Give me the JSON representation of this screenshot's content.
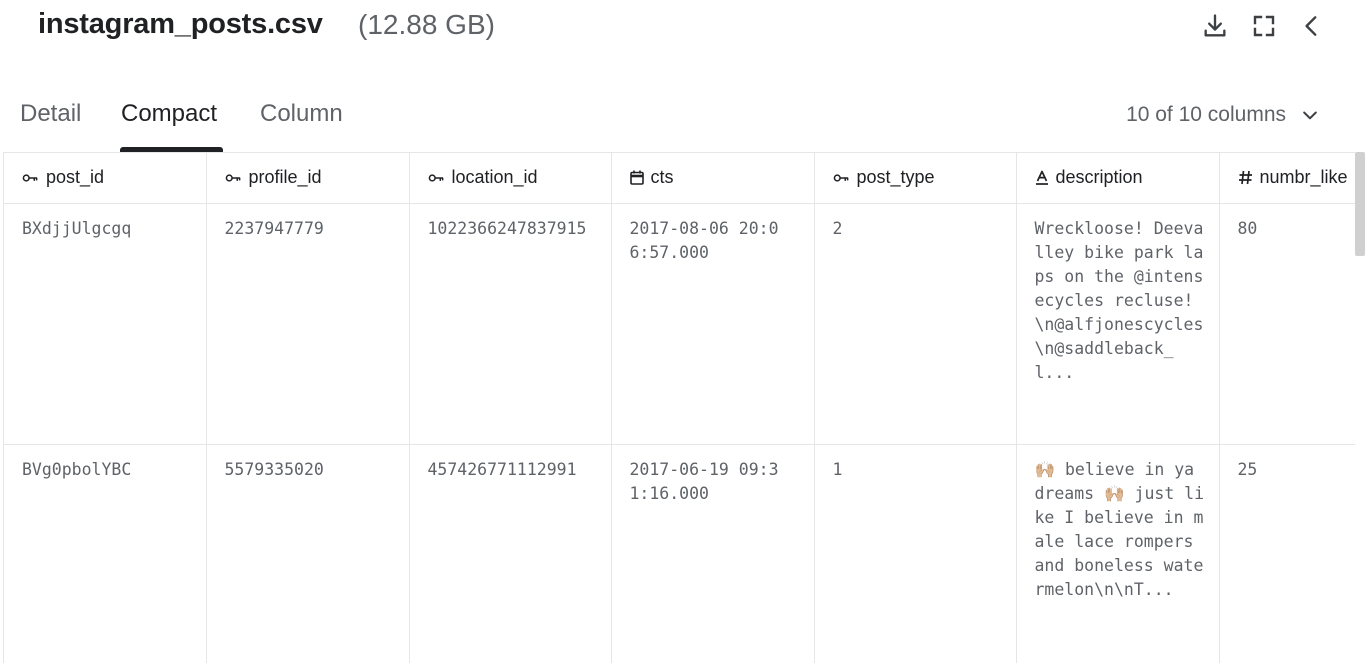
{
  "header": {
    "title": "instagram_posts.csv",
    "size": "(12.88 GB)",
    "icons": [
      "download-icon",
      "fullscreen-icon",
      "chevron-left-icon"
    ]
  },
  "tabs": [
    {
      "label": "Detail",
      "active": false
    },
    {
      "label": "Compact",
      "active": true
    },
    {
      "label": "Column",
      "active": false
    }
  ],
  "column_selector": {
    "label": "10 of 10 columns"
  },
  "table": {
    "columns": [
      {
        "label": "post_id",
        "icon": "key-icon"
      },
      {
        "label": "profile_id",
        "icon": "key-icon"
      },
      {
        "label": "location_id",
        "icon": "key-icon"
      },
      {
        "label": "cts",
        "icon": "calendar-icon"
      },
      {
        "label": "post_type",
        "icon": "key-icon"
      },
      {
        "label": "description",
        "icon": "text-type-icon"
      },
      {
        "label": "numbr_like",
        "icon": "hash-icon"
      }
    ],
    "rows": [
      [
        "BXdjjUlgcgq",
        "2237947779",
        "1022366247837915",
        "2017-08-06 20:06:57.000",
        "2",
        "Wreckloose! Deevalley bike park laps on the @intensecycles recluse!\\n@alfjonescycles \\n@saddleback_l...",
        "80"
      ],
      [
        "BVg0pbolYBC",
        "5579335020",
        "457426771112991",
        "2017-06-19 09:31:16.000",
        "1",
        "🙌🏼 believe in ya dreams 🙌🏼 just like I believe in male lace rompers and boneless watermelon\\n\\nT...",
        "25"
      ]
    ]
  },
  "colors": {
    "accent": "#202124",
    "muted": "#5f6368",
    "border": "#e6e6e6"
  }
}
